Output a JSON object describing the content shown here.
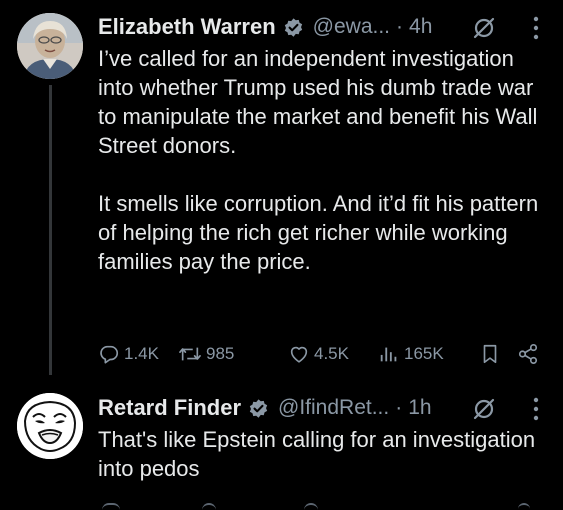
{
  "tweets": [
    {
      "author": {
        "name": "Elizabeth Warren",
        "handle": "@ewa...",
        "verified": true
      },
      "time": "4h",
      "text": "I’ve called for an independent investigation into whether Trump used his dumb trade war to manipulate the market and benefit his Wall Street donors.\n\nIt smells like corruption. And it’d fit his pattern of helping the rich get richer while working families pay the price.",
      "stats": {
        "replies": "1.4K",
        "reposts": "985",
        "likes": "4.5K",
        "views": "165K"
      }
    },
    {
      "author": {
        "name": "Retard Finder",
        "handle": "@IfindRet...",
        "verified": true
      },
      "time": "1h",
      "text": "That's like Epstein calling for an investigation into pedos"
    }
  ],
  "colors": {
    "background": "#000000",
    "primary_text": "#e7e9ea",
    "secondary_text": "#8b98a5",
    "verified_badge": "#8b98a5",
    "thread_line": "#333639"
  },
  "icons": {
    "verified": "verified-badge-icon",
    "grok": "grok-icon",
    "more": "more-vertical-icon",
    "reply": "reply-icon",
    "repost": "repost-icon",
    "like": "heart-icon",
    "views": "views-chart-icon",
    "bookmark": "bookmark-icon",
    "share": "share-icon"
  }
}
